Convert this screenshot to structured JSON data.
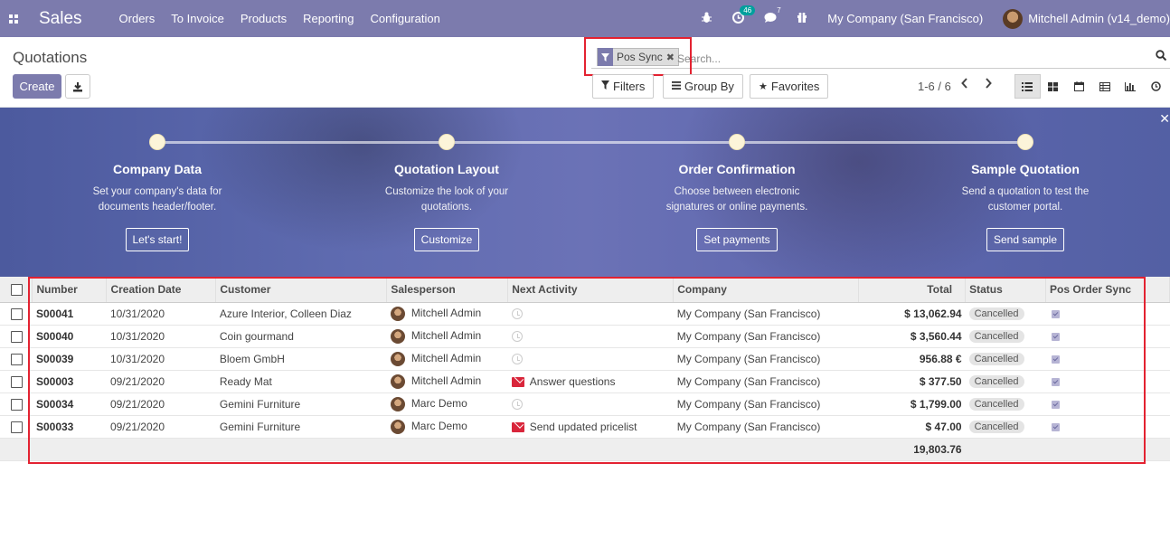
{
  "navbar": {
    "app_name": "Sales",
    "menu": [
      "Orders",
      "To Invoice",
      "Products",
      "Reporting",
      "Configuration"
    ],
    "activity_count": "46",
    "message_count": "7",
    "company": "My Company (San Francisco)",
    "user": "Mitchell Admin (v14_demo)",
    "icons": [
      "apps-icon",
      "bug-icon",
      "activity-clock-icon",
      "chat-icon",
      "gift-icon"
    ]
  },
  "control": {
    "title": "Quotations",
    "create_label": "Create",
    "search_facet": "Pos Sync",
    "search_placeholder": "Search...",
    "filters_label": "Filters",
    "group_by_label": "Group By",
    "favorites_label": "Favorites",
    "pager": "1-6 / 6"
  },
  "banner": {
    "steps": [
      {
        "title": "Company Data",
        "desc": "Set your company's data for documents header/footer.",
        "button": "Let's start!"
      },
      {
        "title": "Quotation Layout",
        "desc": "Customize the look of your quotations.",
        "button": "Customize"
      },
      {
        "title": "Order Confirmation",
        "desc": "Choose between electronic signatures or online payments.",
        "button": "Set payments"
      },
      {
        "title": "Sample Quotation",
        "desc": "Send a quotation to test the customer portal.",
        "button": "Send sample"
      }
    ]
  },
  "table": {
    "columns": [
      "Number",
      "Creation Date",
      "Customer",
      "Salesperson",
      "Next Activity",
      "Company",
      "Total",
      "Status",
      "Pos Order Sync"
    ],
    "rows": [
      {
        "number": "S00041",
        "date": "10/31/2020",
        "customer": "Azure Interior, Colleen Diaz",
        "salesperson": "Mitchell Admin",
        "activity": "",
        "company": "My Company (San Francisco)",
        "total": "$ 13,062.94",
        "status": "Cancelled"
      },
      {
        "number": "S00040",
        "date": "10/31/2020",
        "customer": "Coin gourmand",
        "salesperson": "Mitchell Admin",
        "activity": "",
        "company": "My Company (San Francisco)",
        "total": "$ 3,560.44",
        "status": "Cancelled"
      },
      {
        "number": "S00039",
        "date": "10/31/2020",
        "customer": "Bloem GmbH",
        "salesperson": "Mitchell Admin",
        "activity": "",
        "company": "My Company (San Francisco)",
        "total": "956.88 €",
        "status": "Cancelled"
      },
      {
        "number": "S00003",
        "date": "09/21/2020",
        "customer": "Ready Mat",
        "salesperson": "Mitchell Admin",
        "activity": "Answer questions",
        "company": "My Company (San Francisco)",
        "total": "$ 377.50",
        "status": "Cancelled"
      },
      {
        "number": "S00034",
        "date": "09/21/2020",
        "customer": "Gemini Furniture",
        "salesperson": "Marc Demo",
        "activity": "",
        "company": "My Company (San Francisco)",
        "total": "$ 1,799.00",
        "status": "Cancelled"
      },
      {
        "number": "S00033",
        "date": "09/21/2020",
        "customer": "Gemini Furniture",
        "salesperson": "Marc Demo",
        "activity": "Send updated pricelist",
        "company": "My Company (San Francisco)",
        "total": "$ 47.00",
        "status": "Cancelled"
      }
    ],
    "grand_total": "19,803.76"
  },
  "colors": {
    "brand": "#7c7bad",
    "highlight": "#e32231",
    "activity_email": "#d9263b"
  }
}
